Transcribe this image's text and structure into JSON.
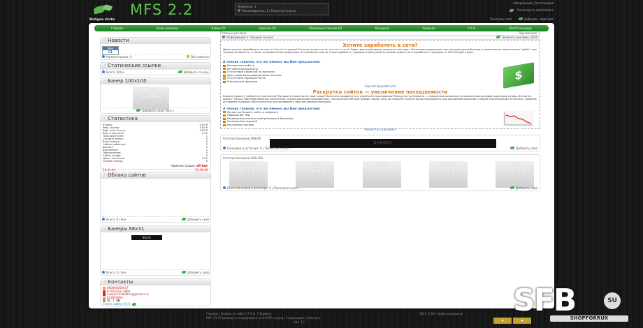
{
  "header": {
    "logo_text": "MFS 2.2",
    "breadcrumb": "Blutigem stroka",
    "ticker_line1": "Инфоблок: 1",
    "ticker_line2": "Рекламодатель: 1 | Посмотреть всех",
    "top_links": "Авторизация | Регистрация",
    "top_right_link": "Посмотреть свой баланс",
    "top_right_link2": "Посетить сайт",
    "top_right_link3": "Добавить свой сайт"
  },
  "nav": {
    "items": [
      "Главная",
      "Заказ рекламы",
      "Клики (0)",
      "Задания (0)",
      "Рекламные письма (0)",
      "Конкурсы",
      "Правила",
      "F.A.Q.",
      "Автотехниаддь"
    ]
  },
  "sidebar": {
    "news": {
      "title": "Новости",
      "calendar_month": "Янв",
      "calendar_day": "01",
      "foot_left": "Комментариев: 0",
      "foot_right": "Все новости"
    },
    "static_links": {
      "title": "Статические ссылки",
      "foot_left": "Всего: 0/0ox",
      "foot_right": "Добавить ссылку"
    },
    "banner100": {
      "title": "Банер 100x100",
      "placeholder": "Место свободно",
      "foot": "Добавить свой | Все »"
    },
    "stats": {
      "title": "Статистика",
      "rows": [
        {
          "label": "Юзеры:",
          "value": "0.00 ₽"
        },
        {
          "label": "Реф. ссылок:",
          "value": "0.00 ₽"
        },
        {
          "label": "Реф. клик 2го ур.:",
          "value": "0.00 ₽"
        },
        {
          "label": "Вып. в выплате:",
          "value": "0.00"
        },
        {
          "label": "Пользователей:",
          "value": "1"
        },
        {
          "label": "Сегодня новых:",
          "value": "0"
        },
        {
          "label": "Всего новых:",
          "value": "0"
        },
        {
          "label": "Сейчас работают:",
          "value": "0"
        },
        {
          "label": "Выплат:",
          "value": "0"
        },
        {
          "label": "Выполнено:",
          "value": "0"
        },
        {
          "label": "Просмотрено:",
          "value": "0"
        },
        {
          "label": "Сайты (серф):",
          "value": "0"
        },
        {
          "label": "Денег на счетах:",
          "value": "0.00"
        },
        {
          "label": "Онлайн сейчас:",
          "value": "0"
        }
      ],
      "admin_label": "Администрация:",
      "admin_status": "off-line",
      "time_left": "22:41:44",
      "time_right": "22:39:48"
    },
    "cloud": {
      "title": "Облако сайтов",
      "foot_left": "Всего: 0 | Все",
      "foot_right": "Добавить свой"
    },
    "banners88": {
      "title": "Банеры 88x31",
      "banner_text": "88x31",
      "foot_left": "Всего: 0 | Все",
      "foot_right": "Добавить свой"
    },
    "contacts": {
      "title": "Контакты",
      "items": [
        "000000000007",
        "R765656213869",
        "support-mobilbox@gmailos.ru",
        "613950904",
        "QL: 1"
      ],
      "score": "26",
      "foot": "Статус сайта: 0 | 0"
    }
  },
  "content": {
    "crumb_left": "Платные реклама",
    "crumb_right": "Просмотров: 1",
    "info_bar_left": "Информация о текущей ссылке",
    "info_bar_right": "Заказать рекламу (30 ₽)",
    "block1": {
      "title": "Хотите заработать в сети?",
      "paragraph": "Давно хотели попробовать на чем-то \"что-то\" стоящее? А как вы хотите на то, что что \"что-то\" будет реальный доход, многие из них ищут. Мы можем предложить вам неограниченный доход за выполнение своих личных \"работ\" или за вашу активность, а также за привлечение рефералов. Это позволит вам не только удобно и с удовольствием, решать разные задачи, но и заработать в среднем от 200-500 руб в день.",
      "list_head": "А теперь главное, что же именно мы Вам предлагаем:",
      "list": [
        "Интересная работа",
        "Мгновенные выплаты",
        "Отсутствие комиссий на выплаты",
        "Двух-уровневая реферальная система",
        "Отсутствие порноконтента",
        "Уникальные функции"
      ],
      "link": "Зарегистрироваться!"
    },
    "block2": {
      "title": "Раскрутка сайтов — увеличение посещаемости",
      "paragraph": "Вашему проекту требуются посетители? Вы ищете клиентов на свой товар? Вы хотите продвинуться в рейтинге поисковиков? Раскрутка на Seosprint — прекрасная возможность привлечения целевой аудитории на ваш Интернет-проект. Только заинтересованные посетители, только реальные пользователи, только качественный трафик. Кроме того, вы сможете полностью контролировать ход рекламной кампании с вашей персональной статистики, удобный интерфейс позволит Вам полностью контролировать свои рекламные кампании.",
      "list_head": "А теперь главное, что же именно мы Вам предлагаем:",
      "list": [
        "Раскрутка Вашего сайта в серфинге",
        "Повышение ТИЦ",
        "Размещение контекстной рекламы и баннеров",
        "Размещение заданий",
        "Рекламные письма"
      ],
      "link": "Разместить рекламу!"
    },
    "rotator1": {
      "title": "Ротатор баннеров 468x60",
      "banner_text": "BANNER",
      "foot_left": "Баннеров в ротаторе: 0 | Посмотреть все »",
      "foot_right": "Добавить свой"
    },
    "rotator2": {
      "title": "Ротатор баннеров 100x100",
      "placeholder": "Место свободно",
      "foot_left": "Всего баннеров в ротаторе: 0 | Посмотреть все »",
      "foot_right": "Добавить свой"
    }
  },
  "footer": {
    "line1": "Главная | Наверх на сайте | F.A.Q. | Правила",
    "line2": "PHP: 21 | Страница сгенерирована за 0.0417 секунд | Следующий | Свернуть",
    "line3": "Кол. 1 | ...",
    "copyright": "2011 © Все права защищены"
  },
  "watermark": {
    "text": "SFB",
    "badge": "SU",
    "sub": "SHOPFORRUX"
  }
}
